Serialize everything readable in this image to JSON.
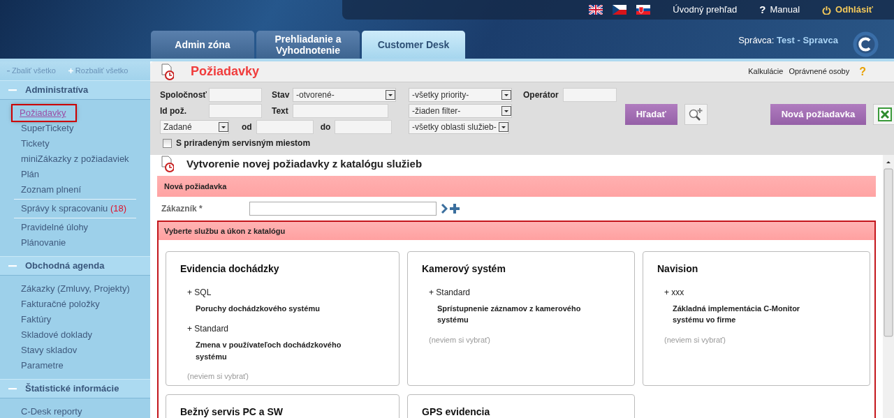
{
  "top_bar": {
    "flags": [
      {
        "kind": "uk"
      },
      {
        "kind": "cz"
      },
      {
        "kind": "sk"
      }
    ],
    "links": [
      {
        "kind": "plain",
        "label": "Úvodný prehľad"
      },
      {
        "kind": "help",
        "icon": "?",
        "label": "Manual"
      },
      {
        "kind": "logout",
        "label": "Odhlásiť"
      }
    ]
  },
  "tabs": [
    {
      "label": "Admin zóna",
      "selected": false
    },
    {
      "label": "Prehliadanie a Vyhodnotenie",
      "selected": false
    },
    {
      "label": "Customer Desk",
      "selected": true
    }
  ],
  "user": {
    "label": "Správca:",
    "name": "Test - Spravca"
  },
  "sidebar": {
    "collapse_all": "Zbaliť všetko",
    "expand_all": "Rozbaliť všetko",
    "sections": [
      {
        "title": "Administratíva",
        "expanded": true,
        "groups": [
          [
            {
              "label": "Požiadavky",
              "selected": true
            },
            {
              "label": "SuperTickety",
              "selected": false
            },
            {
              "label": "Tickety",
              "selected": false
            },
            {
              "label": "miniZákazky z požiadaviek",
              "selected": false
            },
            {
              "label": "Plán",
              "selected": false
            },
            {
              "label": "Zoznam plnení",
              "selected": false
            }
          ],
          [
            {
              "label": "Správy k spracovaniu",
              "count": "(18)",
              "selected": false
            }
          ],
          [
            {
              "label": "Pravidelné úlohy",
              "selected": false
            },
            {
              "label": "Plánovanie",
              "selected": false
            }
          ]
        ]
      },
      {
        "title": "Obchodná agenda",
        "expanded": true,
        "groups": [
          [
            {
              "label": "Zákazky (Zmluvy, Projekty)",
              "selected": false
            },
            {
              "label": "Fakturačné položky",
              "selected": false
            },
            {
              "label": "Faktúry",
              "selected": false
            },
            {
              "label": "Skladové doklady",
              "selected": false
            },
            {
              "label": "Stavy skladov",
              "selected": false
            },
            {
              "label": "Parametre",
              "selected": false
            }
          ]
        ]
      },
      {
        "title": "Štatistické informácie",
        "expanded": true,
        "groups": [
          [
            {
              "label": "C-Desk reporty",
              "selected": false
            }
          ]
        ]
      }
    ]
  },
  "page": {
    "title": "Požiadavky",
    "links": [
      "Kalkulácie",
      "Oprávnené osoby"
    ],
    "help": "?"
  },
  "filters": {
    "rows": [
      [
        {
          "kind": "label",
          "text": "Spoločnosť"
        },
        {
          "kind": "input"
        },
        {
          "kind": "label",
          "text": "Stav"
        },
        {
          "kind": "select",
          "value": "-otvorené-"
        }
      ],
      [
        {
          "kind": "label",
          "text": "Id pož."
        },
        {
          "kind": "input"
        },
        {
          "kind": "label",
          "text": "Text"
        },
        {
          "kind": "input"
        }
      ]
    ],
    "date_row": {
      "select": "Zadané",
      "from_label": "od",
      "to_label": "do"
    },
    "selects": [
      "-všetky priority-",
      "-žiaden filter-",
      "-všetky oblasti služieb-"
    ],
    "operator_label": "Operátor",
    "checkbox": {
      "label": "S priradeným servisným miestom",
      "checked": false
    },
    "search_button": "Hľadať",
    "new_button": "Nová požiadavka"
  },
  "create": {
    "title": "Vytvorenie novej požiadavky z katalógu služieb",
    "band": "Nová požiadavka",
    "customer_label": "Zákazník *",
    "catalog": {
      "title": "Vyberte službu a úkon z katalógu",
      "services": [
        {
          "title": "Evidencia dochádzky",
          "entries": [
            {
              "variant": "+ SQL",
              "tasks": [
                "Poruchy dochádzkového systému"
              ]
            },
            {
              "variant": "+ Standard",
              "tasks": [
                "Zmena v používateľoch dochádzkového systému"
              ]
            }
          ],
          "unsure": "(neviem si vybrať)"
        },
        {
          "title": "Kamerový systém",
          "entries": [
            {
              "variant": "+ Standard",
              "tasks": [
                "Sprístupnenie záznamov z kamerového systému"
              ]
            }
          ],
          "unsure": "(neviem si vybrať)"
        },
        {
          "title": "Navision",
          "entries": [
            {
              "variant": "+ xxx",
              "tasks": [
                "Základná implementácia C-Monitor systému vo firme"
              ]
            }
          ],
          "unsure": "(neviem si vybrať)"
        },
        {
          "title": "Bežný servis PC a SW"
        },
        {
          "title": "GPS evidencia"
        }
      ]
    }
  }
}
